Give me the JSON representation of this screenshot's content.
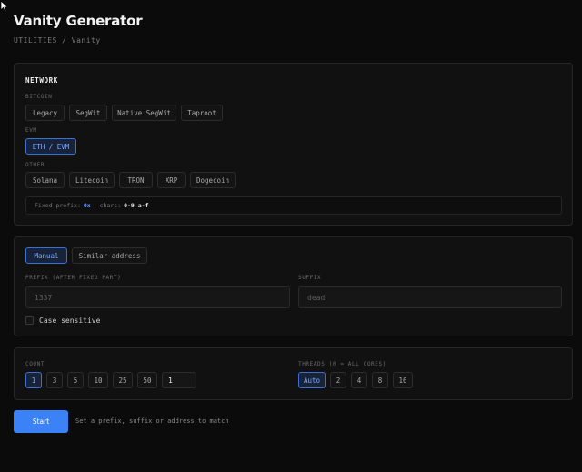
{
  "page": {
    "title": "Vanity Generator",
    "breadcrumb": "UTILITIES / Vanity"
  },
  "network": {
    "title": "NETWORK",
    "bitcoin_label": "BITCOIN",
    "bitcoin_options": [
      "Legacy",
      "SegWit",
      "Native SegWit",
      "Taproot"
    ],
    "evm_label": "EVM",
    "evm_options": [
      "ETH / EVM"
    ],
    "evm_selected": "ETH / EVM",
    "other_label": "OTHER",
    "other_options": [
      "Solana",
      "Litecoin",
      "TRON",
      "XRP",
      "Dogecoin"
    ],
    "info_prefix_label": "Fixed prefix:",
    "info_prefix_value": "0x",
    "info_sep": "·",
    "info_chars_label": "chars:",
    "info_chars_value": "0-9 a-f"
  },
  "pattern": {
    "mode_tabs": [
      "Manual",
      "Similar address"
    ],
    "mode_selected": "Manual",
    "prefix_label": "PREFIX (AFTER FIXED PART)",
    "prefix_placeholder": "1337",
    "suffix_label": "SUFFIX",
    "suffix_placeholder": "dead",
    "case_sensitive_label": "Case sensitive",
    "case_sensitive_checked": false
  },
  "run": {
    "count_label": "COUNT",
    "count_options": [
      "1",
      "3",
      "5",
      "10",
      "25",
      "50"
    ],
    "count_selected": "1",
    "count_input_value": "1",
    "threads_label": "THREADS (0 = ALL CORES)",
    "thread_options": [
      "Auto",
      "2",
      "4",
      "8",
      "16"
    ],
    "threads_selected": "Auto"
  },
  "actions": {
    "start_label": "Start",
    "hint": "Set a prefix, suffix or address to match"
  },
  "colors": {
    "accent": "#3b82f6",
    "active_chip_bg": "#172338",
    "active_chip_border": "#3b6fd8",
    "background": "#0b0b0b",
    "card": "#111111"
  }
}
